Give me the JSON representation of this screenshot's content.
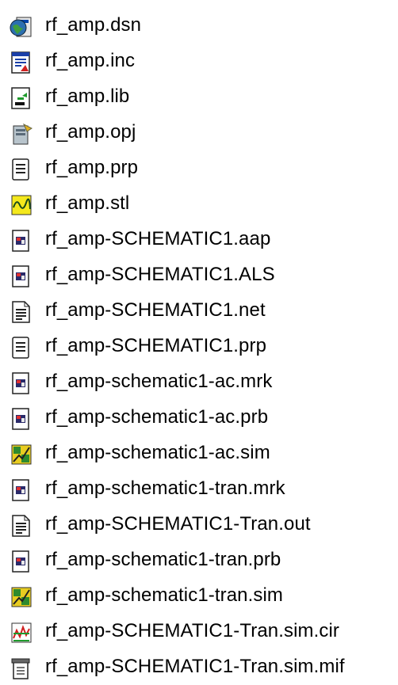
{
  "files": [
    {
      "name": "rf_amp.dsn",
      "icon": "globe-design-icon"
    },
    {
      "name": "rf_amp.inc",
      "icon": "text-doc-red-icon"
    },
    {
      "name": "rf_amp.lib",
      "icon": "library-doc-icon"
    },
    {
      "name": "rf_amp.opj",
      "icon": "project-doc-icon"
    },
    {
      "name": "rf_amp.prp",
      "icon": "notepad-doc-icon"
    },
    {
      "name": "rf_amp.stl",
      "icon": "waveform-doc-icon"
    },
    {
      "name": "rf_amp-SCHEMATIC1.aap",
      "icon": "app-doc-icon"
    },
    {
      "name": "rf_amp-SCHEMATIC1.ALS",
      "icon": "app-doc-icon"
    },
    {
      "name": "rf_amp-SCHEMATIC1.net",
      "icon": "text-doc-icon"
    },
    {
      "name": "rf_amp-SCHEMATIC1.prp",
      "icon": "notepad-doc-icon"
    },
    {
      "name": "rf_amp-schematic1-ac.mrk",
      "icon": "app-doc-icon"
    },
    {
      "name": "rf_amp-schematic1-ac.prb",
      "icon": "app-doc-icon"
    },
    {
      "name": "rf_amp-schematic1-ac.sim",
      "icon": "simulation-profile-icon"
    },
    {
      "name": "rf_amp-schematic1-tran.mrk",
      "icon": "app-doc-icon"
    },
    {
      "name": "rf_amp-SCHEMATIC1-Tran.out",
      "icon": "text-doc-icon"
    },
    {
      "name": "rf_amp-schematic1-tran.prb",
      "icon": "app-doc-icon"
    },
    {
      "name": "rf_amp-schematic1-tran.sim",
      "icon": "simulation-profile-icon"
    },
    {
      "name": "rf_amp-SCHEMATIC1-Tran.sim.cir",
      "icon": "circuit-doc-icon"
    },
    {
      "name": "rf_amp-SCHEMATIC1-Tran.sim.mif",
      "icon": "generic-doc-icon"
    }
  ]
}
